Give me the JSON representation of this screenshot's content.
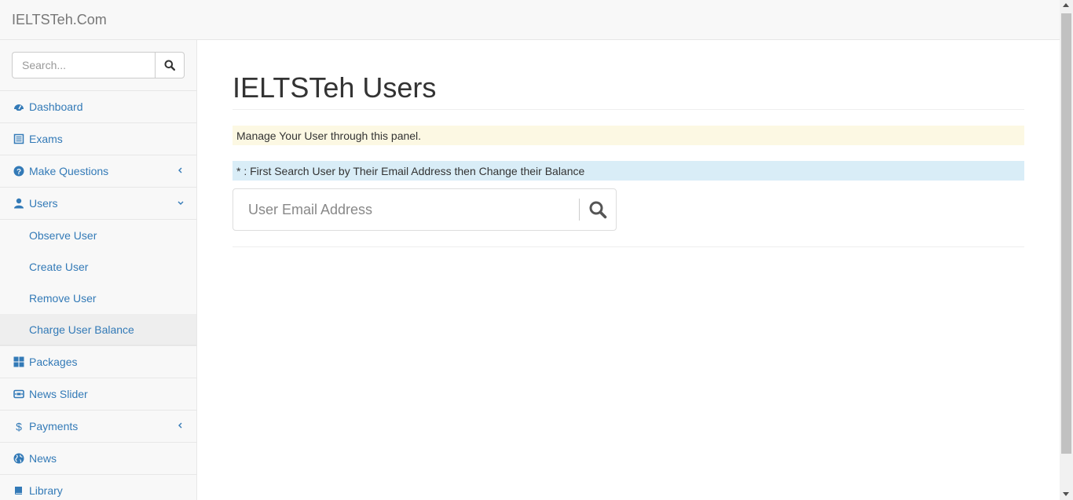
{
  "header": {
    "brand": "IELTSTeh.Com"
  },
  "sidebar": {
    "search_placeholder": "Search...",
    "items": [
      {
        "label": "Dashboard",
        "icon": "dashboard-icon"
      },
      {
        "label": "Exams",
        "icon": "list-icon"
      },
      {
        "label": "Make Questions",
        "icon": "question-circle-icon",
        "arrow": "chevron-left-icon"
      },
      {
        "label": "Users",
        "icon": "user-icon",
        "arrow": "chevron-down-icon"
      },
      {
        "label": "Packages",
        "icon": "grid-icon"
      },
      {
        "label": "News Slider",
        "icon": "slider-icon"
      },
      {
        "label": "Payments",
        "icon": "dollar-icon",
        "arrow": "chevron-left-icon"
      },
      {
        "label": "News",
        "icon": "globe-icon"
      },
      {
        "label": "Library",
        "icon": "book-icon"
      }
    ],
    "users_sub": [
      "Observe User",
      "Create User",
      "Remove User",
      "Charge User Balance"
    ]
  },
  "main": {
    "title": "IELTSTeh Users",
    "warning_text": "Manage Your User through this panel.",
    "info_text": "* : First Search User by Their Email Address then Change their Balance",
    "email_placeholder": "User Email Address"
  },
  "colors": {
    "link": "#337ab7",
    "warning_bg": "#fcf8e3",
    "info_bg": "#d9edf7"
  }
}
